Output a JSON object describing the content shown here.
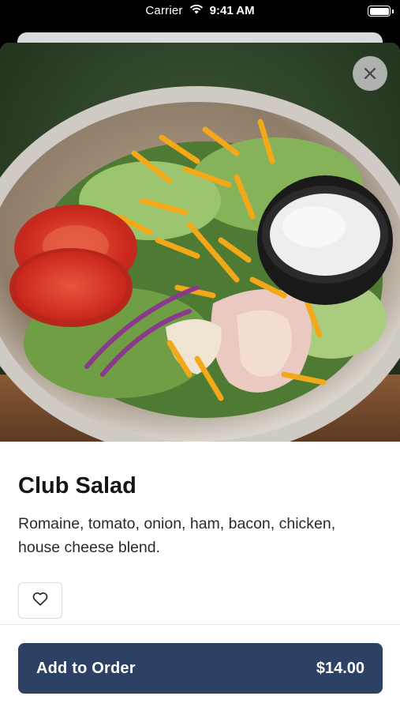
{
  "status_bar": {
    "carrier": "Carrier",
    "time": "9:41 AM",
    "battery_level": 1.0
  },
  "hero_image": {
    "description_icon": "salad-photo"
  },
  "close_icon": "close-icon",
  "item": {
    "title": "Club Salad",
    "description": "Romaine, tomato, onion, ham, bacon, chicken, house cheese blend."
  },
  "favorite_icon": "heart-icon",
  "order_button": {
    "label": "Add to Order",
    "price": "$14.00"
  },
  "colors": {
    "primary_button": "#2c4163",
    "text": "#151515"
  }
}
